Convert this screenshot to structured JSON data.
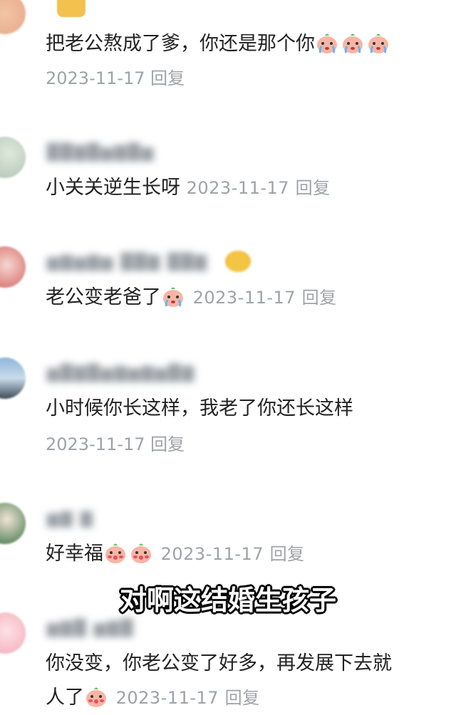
{
  "comments": [
    {
      "text": "把老公熬成了爹，你还是那个你",
      "emojis": [
        "crying-peach",
        "crying-peach",
        "crying-peach"
      ],
      "date": "2023-11-17",
      "reply": "回复",
      "meta_inline": false
    },
    {
      "text": "小关关逆生长呀",
      "emojis": [],
      "date": "2023-11-17",
      "reply": "回复",
      "meta_inline": true
    },
    {
      "text": "老公变老爸了",
      "emojis": [
        "crying-peach"
      ],
      "date": "2023-11-17",
      "reply": "回复",
      "meta_inline": true
    },
    {
      "text": "小时候你长这样，我老了你还长这样",
      "emojis": [],
      "date": "2023-11-17",
      "reply": "回复",
      "meta_inline": false
    },
    {
      "text": "好幸福",
      "emojis": [
        "blushing-peach",
        "blushing-peach"
      ],
      "date": "2023-11-17",
      "reply": "回复",
      "meta_inline": true
    },
    {
      "text": "你没变，你老公变了好多，再发展下去就",
      "text_line2": "人了",
      "emojis": [
        "blushing-peach"
      ],
      "date": "2023-11-17",
      "reply": "回复",
      "meta_inline": true
    }
  ],
  "subtitle": "对啊这结婚生孩子",
  "colors": {
    "text": "#222222",
    "meta": "#9ea2a8",
    "background": "#ffffff",
    "subtitle": "#ffffff",
    "subtitle_outline": "#000000"
  }
}
